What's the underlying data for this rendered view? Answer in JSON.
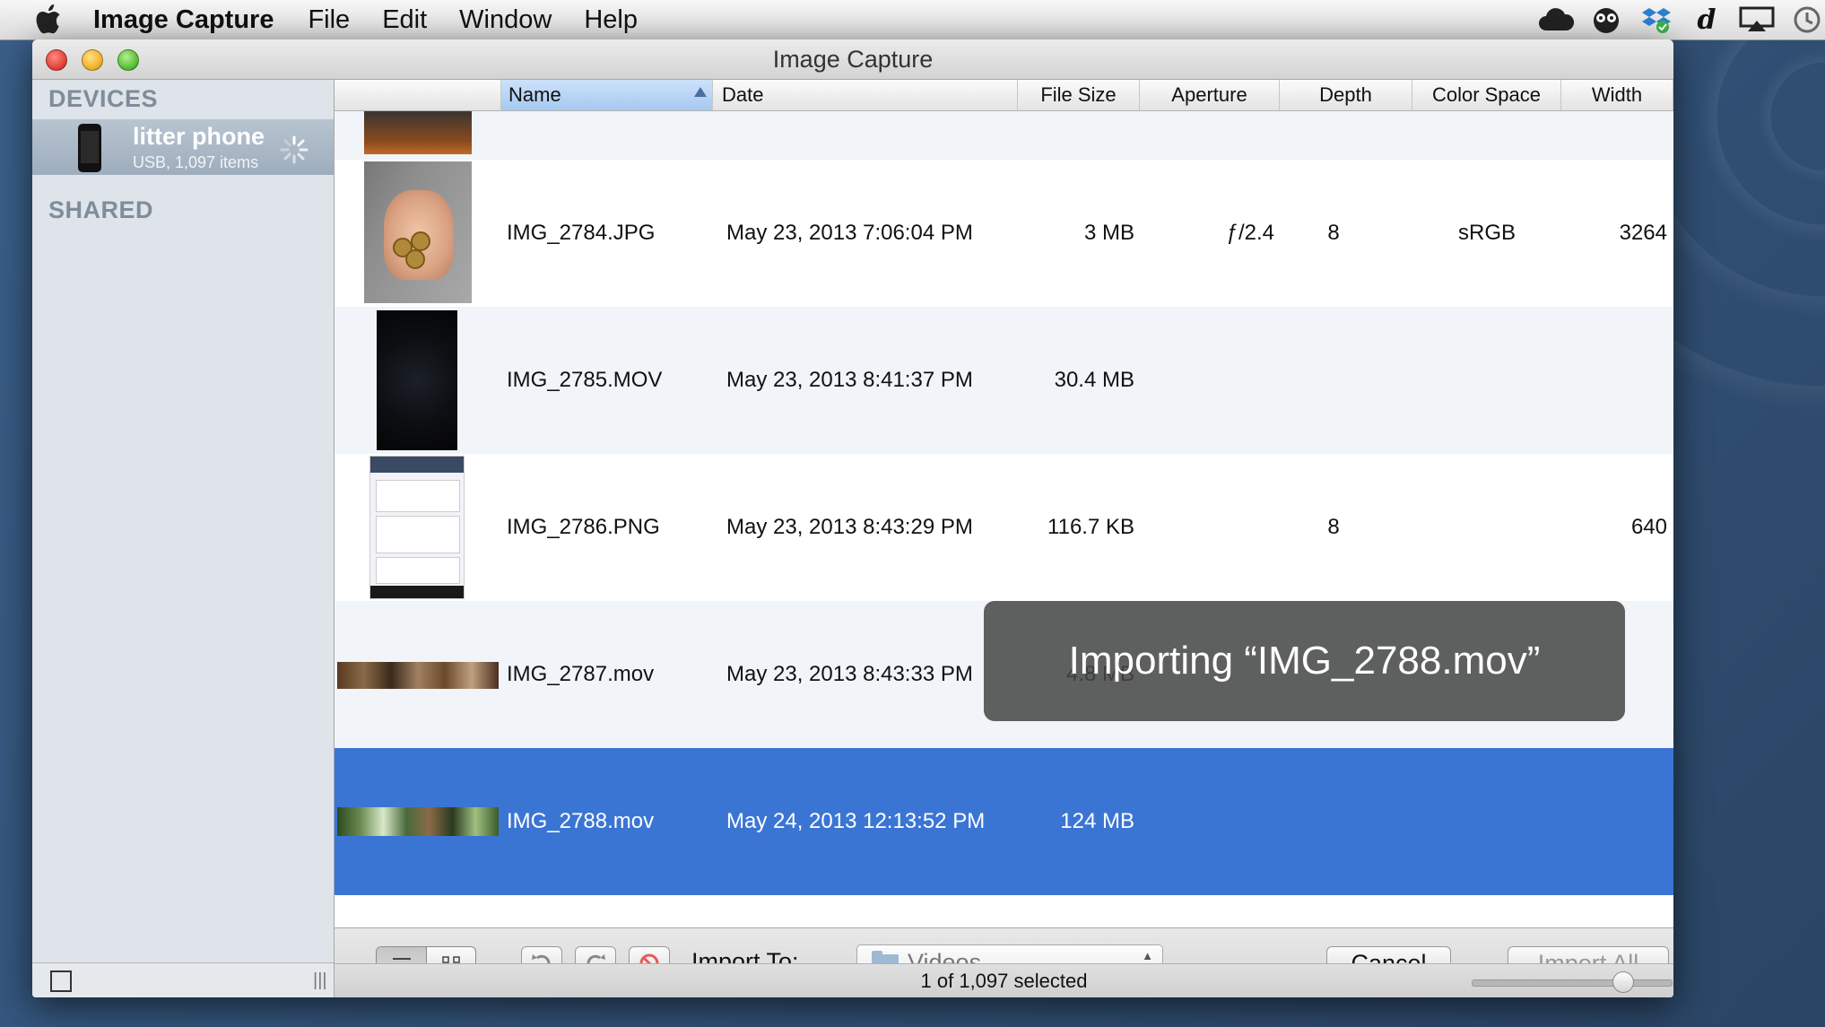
{
  "menubar": {
    "app_name": "Image Capture",
    "items": [
      "File",
      "Edit",
      "Window",
      "Help"
    ],
    "extras": [
      "cloud-icon",
      "owl-icon",
      "dropbox-icon",
      "dictionary-icon",
      "airplay-icon",
      "time-machine-icon"
    ]
  },
  "window": {
    "title": "Image Capture"
  },
  "sidebar": {
    "devices_heading": "DEVICES",
    "device_name": "litter phone",
    "device_sub": "USB, 1,097 items",
    "shared_heading": "SHARED"
  },
  "table": {
    "columns": [
      "Name",
      "Date",
      "File Size",
      "Aperture",
      "Depth",
      "Color Space",
      "Width"
    ],
    "sorted_column": "Name",
    "rows": [
      {
        "name": "IMG_2784.JPG",
        "date": "May 23, 2013 7:06:04 PM",
        "size": "3 MB",
        "aperture": "ƒ/2.4",
        "depth": "8",
        "color_space": "sRGB",
        "width": "3264",
        "thumb": "coins-in-hand"
      },
      {
        "name": "IMG_2785.MOV",
        "date": "May 23, 2013 8:41:37 PM",
        "size": "30.4 MB",
        "aperture": "",
        "depth": "",
        "color_space": "",
        "width": "",
        "thumb": "dark-video"
      },
      {
        "name": "IMG_2786.PNG",
        "date": "May 23, 2013 8:43:29 PM",
        "size": "116.7 KB",
        "aperture": "",
        "depth": "8",
        "color_space": "",
        "width": "640",
        "thumb": "phone-screenshot"
      },
      {
        "name": "IMG_2787.mov",
        "date": "May 23, 2013 8:43:33 PM",
        "size": "4.8 MB",
        "aperture": "",
        "depth": "",
        "color_space": "",
        "width": "",
        "thumb": "panorama-room"
      },
      {
        "name": "IMG_2788.mov",
        "date": "May 24, 2013 12:13:52 PM",
        "size": "124 MB",
        "aperture": "",
        "depth": "",
        "color_space": "",
        "width": "",
        "thumb": "panorama-trees",
        "selected": true
      }
    ]
  },
  "overlay": {
    "text": "Importing “IMG_2788.mov”"
  },
  "toolbar": {
    "import_label": "Import To:",
    "import_destination": "Videos",
    "cancel_label": "Cancel",
    "import_all_label": "Import All"
  },
  "status": {
    "selection_text": "1 of 1,097 selected",
    "thumbnail_size": 0.78
  }
}
